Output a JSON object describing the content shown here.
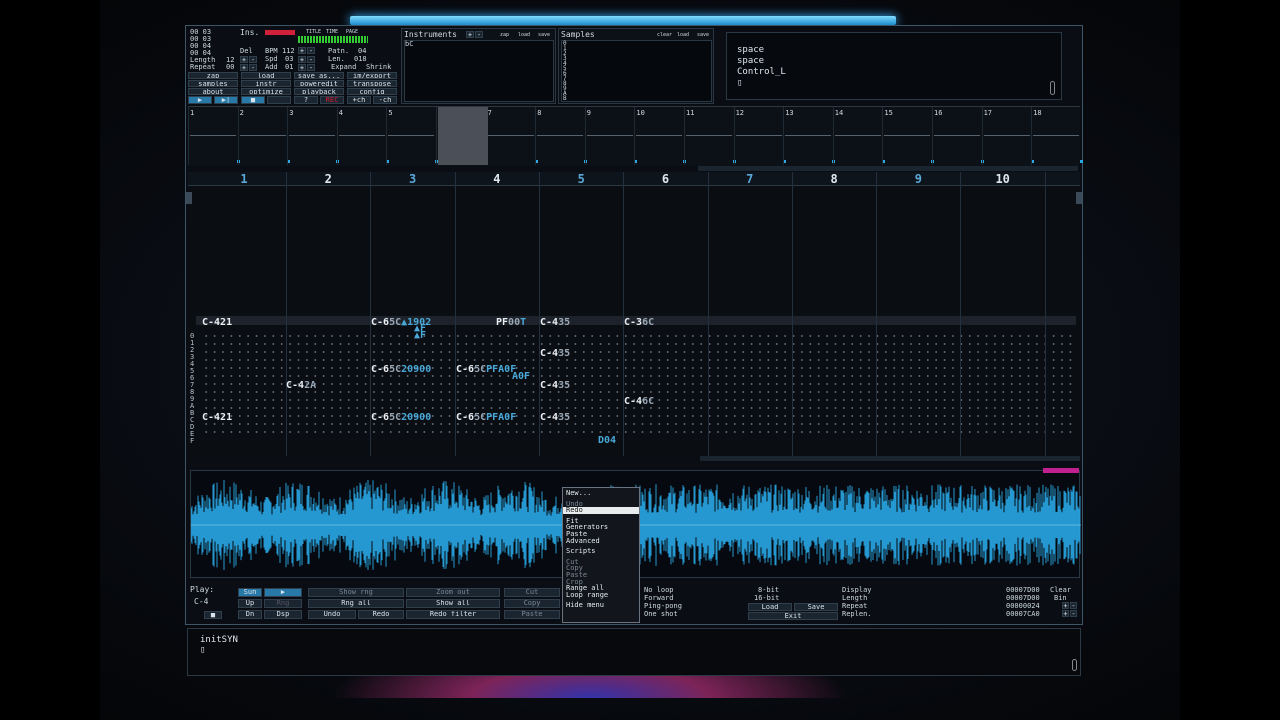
{
  "top_left": {
    "rows": [
      "00 03",
      "00 03",
      "00 04",
      "00 04"
    ],
    "ins_label": "Ins.",
    "length_label": "Length",
    "length_value": "12",
    "repeat_label": "Repeat",
    "repeat_value": "00",
    "del_label": "Del",
    "bpm_label": "BPM",
    "bpm_value": "112",
    "spd_label": "Spd",
    "spd_value": "03",
    "add_label": "Add",
    "add_value": "01",
    "patn_label": "Patn.",
    "patn_value": "04",
    "len_label": "Len.",
    "len_value": "018",
    "expand_label": "Expand",
    "shrink_label": "Shrink",
    "title_labels": [
      "TITLE",
      "TIME",
      "PAGE"
    ]
  },
  "buttons": {
    "zap": "zap",
    "load": "load",
    "save_as": "save as...",
    "im_export": "im/export",
    "samples": "samples",
    "instr": "instr",
    "poweredit": "poweredit",
    "transpose": "transpose",
    "about": "about",
    "optimize": "optimize",
    "playback": "playback",
    "config": "config",
    "q": "?",
    "rec": "REC",
    "add_ch": "+ch",
    "rem_ch": "-ch"
  },
  "instruments": {
    "title": "Instruments",
    "zap": "zap",
    "load": "load",
    "save": "save",
    "item": "bC"
  },
  "samples": {
    "title": "Samples",
    "clear": "clear",
    "load": "load",
    "save": "save",
    "numbers": [
      "0",
      "1",
      "2",
      "3",
      "4",
      "5",
      "6",
      "7",
      "8",
      "9",
      "A",
      "B"
    ]
  },
  "keys": {
    "lines": [
      "space",
      "space",
      "Control_L"
    ],
    "cursor": "▯"
  },
  "timeline": [
    "1",
    "2",
    "3",
    "4",
    "5",
    "6",
    "7",
    "8",
    "9",
    "10",
    "11",
    "12",
    "13",
    "14",
    "15",
    "16",
    "17",
    "18"
  ],
  "channels": [
    "1",
    "2",
    "3",
    "4",
    "5",
    "6",
    "7",
    "8",
    "9",
    "10"
  ],
  "row_numbers": [
    "0",
    "1",
    "2",
    "3",
    "4",
    "5",
    "6",
    "7",
    "8",
    "9",
    "A",
    "B",
    "C",
    "D",
    "E",
    "F"
  ],
  "pattern_cells": [
    {
      "t": "C-421"
    },
    {
      "t": "C-6",
      "h": "5C",
      "c": "▲1902"
    },
    {
      "t": "PF",
      "c": "T",
      "h": "00"
    },
    {
      "t": "C-4",
      "h": "35"
    },
    {
      "t": "C-3",
      "h": "6C"
    },
    {
      "t": "▲F"
    },
    {
      "t": "▲F"
    },
    {
      "t": "C-4",
      "h": "35"
    },
    {
      "t": "C-6",
      "h": "5C",
      "c": "2090",
      "h2": "0"
    },
    {
      "t": "C-6",
      "h": "5C",
      "c": "PF",
      "h2": "A0F"
    },
    {
      "t": "A0F"
    },
    {
      "t": "C-4",
      "h": "2A"
    },
    {
      "t": "C-4",
      "h": "35"
    },
    {
      "t": "C-4",
      "h": "6C"
    },
    {
      "t": "C-421"
    },
    {
      "t": "C-6",
      "h": "5C",
      "c": "2090",
      "h2": "0"
    },
    {
      "t": "C-6",
      "h": "5C",
      "c": "PF",
      "h2": "A0F"
    },
    {
      "t": "C-4",
      "h": "35"
    },
    {
      "t": "D04"
    }
  ],
  "context_menu": [
    "New...",
    "Undo",
    "Redo",
    "Fit",
    "Generators",
    "Paste",
    "Advanced",
    "Scripts",
    "Cut",
    "Copy",
    "Paste",
    "Crop",
    "Range all",
    "Loop range",
    "Hide menu"
  ],
  "bottom": {
    "play_label": "Play:",
    "note": "C-4",
    "sun": "Sun",
    "up": "Up",
    "dn": "Dn",
    "rng": "Rng",
    "dsp": "Dsp",
    "stop": "■",
    "show_rng": "Show rng",
    "rng_all": "Rng all",
    "undo": "Undo",
    "zoom_out": "Zoom out",
    "show_all": "Show all",
    "redo": "Redo",
    "redo_filter": "Redo filter",
    "cut": "Cut",
    "copy": "Copy",
    "paste": "Paste",
    "no_loop": "No loop",
    "forward": "Forward",
    "ping_pong": "Ping-pong",
    "one_shot": "One shot",
    "bit8": "8-bit",
    "bit16": "16-bit",
    "load": "Load",
    "save": "Save",
    "exit": "Exit",
    "display": "Display",
    "length": "Length",
    "repeat": "Repeat",
    "replen": "Replen.",
    "display_val": "00007D00",
    "length_val": "00007D00",
    "repeat_val": "00000024",
    "replen_val": "00007CA0",
    "clear": "Clear",
    "bin": "Bin"
  },
  "console": {
    "text": "initSYN",
    "cursor": "▯"
  },
  "colors": {
    "accent": "#2aa8e6",
    "highlight": "#4aa8d8",
    "rec": "#d0203a"
  }
}
